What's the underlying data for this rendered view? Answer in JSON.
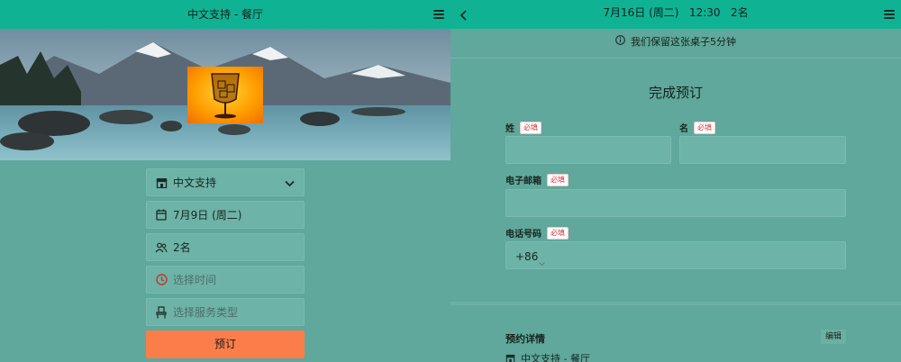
{
  "left": {
    "header_title": "中文支持 - 餐厅",
    "fields": {
      "location": "中文支持",
      "date": "7月9日 (周二)",
      "party": "2名",
      "time_placeholder": "选择时间",
      "service_placeholder": "选择服务类型"
    },
    "book_button": "预订"
  },
  "right": {
    "header_title": "7月16日 (周二)   12:30   2名",
    "notice": "我们保留这张桌子5分钟",
    "form_title": "完成预订",
    "labels": {
      "last_name": "姓",
      "first_name": "名",
      "email": "电子邮箱",
      "phone": "电话号码",
      "required": "必填"
    },
    "phone_prefix": "+86",
    "details_title": "预约详情",
    "edit_button": "编辑",
    "detail_location": "中文支持 - 餐厅"
  },
  "colors": {
    "header": "#0fb394",
    "background": "#5fa89b",
    "book_button": "#fb7e4a",
    "clock_icon": "#c0392b"
  },
  "icons": [
    "menu-icon",
    "store-icon",
    "chevron-down-icon",
    "calendar-icon",
    "people-icon",
    "clock-icon",
    "chair-icon",
    "back-arrow-icon",
    "info-icon"
  ]
}
